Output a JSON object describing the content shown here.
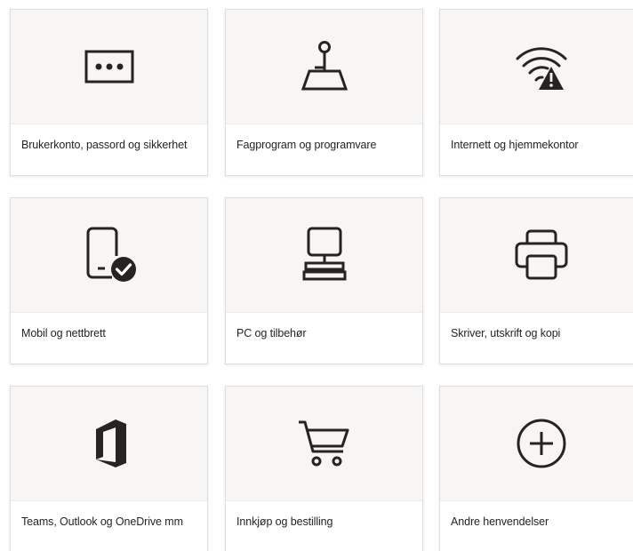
{
  "tiles": [
    {
      "label": "Brukerkonto, passord og sikkerhet",
      "icon": "password-dots-icon"
    },
    {
      "label": "Fagprogram og programvare",
      "icon": "joystick-icon"
    },
    {
      "label": "Internett og hjemmekontor",
      "icon": "wifi-warning-icon"
    },
    {
      "label": "Mobil og nettbrett",
      "icon": "phone-check-icon"
    },
    {
      "label": "PC og tilbehør",
      "icon": "desktop-pc-icon"
    },
    {
      "label": "Skriver, utskrift og kopi",
      "icon": "printer-icon"
    },
    {
      "label": "Teams, Outlook og OneDrive mm",
      "icon": "office-icon"
    },
    {
      "label": "Innkjøp og bestilling",
      "icon": "shopping-cart-icon"
    },
    {
      "label": "Andre henvendelser",
      "icon": "plus-circle-icon"
    }
  ]
}
